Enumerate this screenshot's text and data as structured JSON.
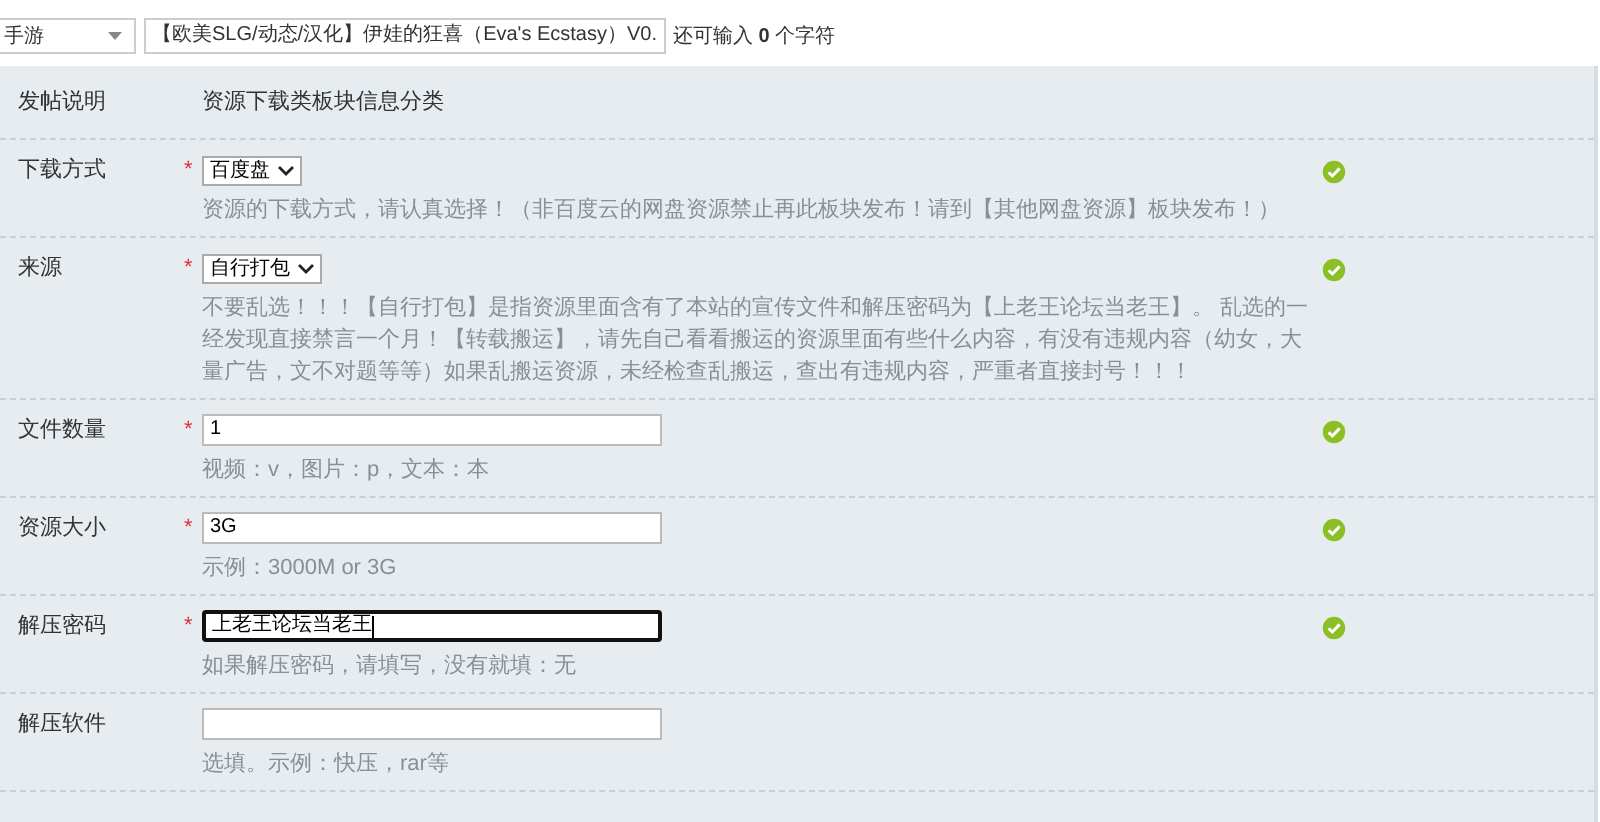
{
  "top_bar": {
    "category": "手游",
    "title_value": "【欧美SLG/动态/汉化】伊娃的狂喜（Eva's Ecstasy）V0.",
    "counter": "还可输入 **0** 个字符"
  },
  "header": {
    "label": "发帖说明",
    "value": "资源下载类板块信息分类"
  },
  "rows": [
    {
      "label": "下载方式",
      "required_mark": "*",
      "kind": "select",
      "value": "百度盘",
      "hint": "资源的下载方式，请认真选择！（非百度云的网盘资源禁止再此板块发布！请到【其他网盘资源】板块发布！）",
      "valid": true,
      "focused": false
    },
    {
      "label": "来源",
      "required_mark": "*",
      "kind": "select",
      "value": "自行打包",
      "hint": "不要乱选！！！【自行打包】是指资源里面含有了本站的宣传文件和解压密码为【上老王论坛当老王】。 乱选的一经发现直接禁言一个月！【转载搬运】，请先自己看看搬运的资源里面有些什么内容，有没有违规内容（幼女，大量广告，文不对题等等）如果乱搬运资源，未经检查乱搬运，查出有违规内容，严重者直接封号！！！",
      "valid": true,
      "focused": false
    },
    {
      "label": "文件数量",
      "required_mark": "*",
      "kind": "text",
      "value": "1",
      "hint": "视频：v，图片：p，文本：本",
      "valid": true,
      "focused": false
    },
    {
      "label": "资源大小",
      "required_mark": "*",
      "kind": "text",
      "value": "3G",
      "hint": "示例：3000M or 3G",
      "valid": true,
      "focused": false
    },
    {
      "label": "解压密码",
      "required_mark": "*",
      "kind": "text",
      "value": "上老王论坛当老王",
      "hint": "如果解压密码，请填写，没有就填：无",
      "valid": true,
      "focused": true
    },
    {
      "label": "解压软件",
      "kind": "text",
      "hint": "选填。示例：快压，rar等",
      "valid": false,
      "focused": false
    }
  ]
}
